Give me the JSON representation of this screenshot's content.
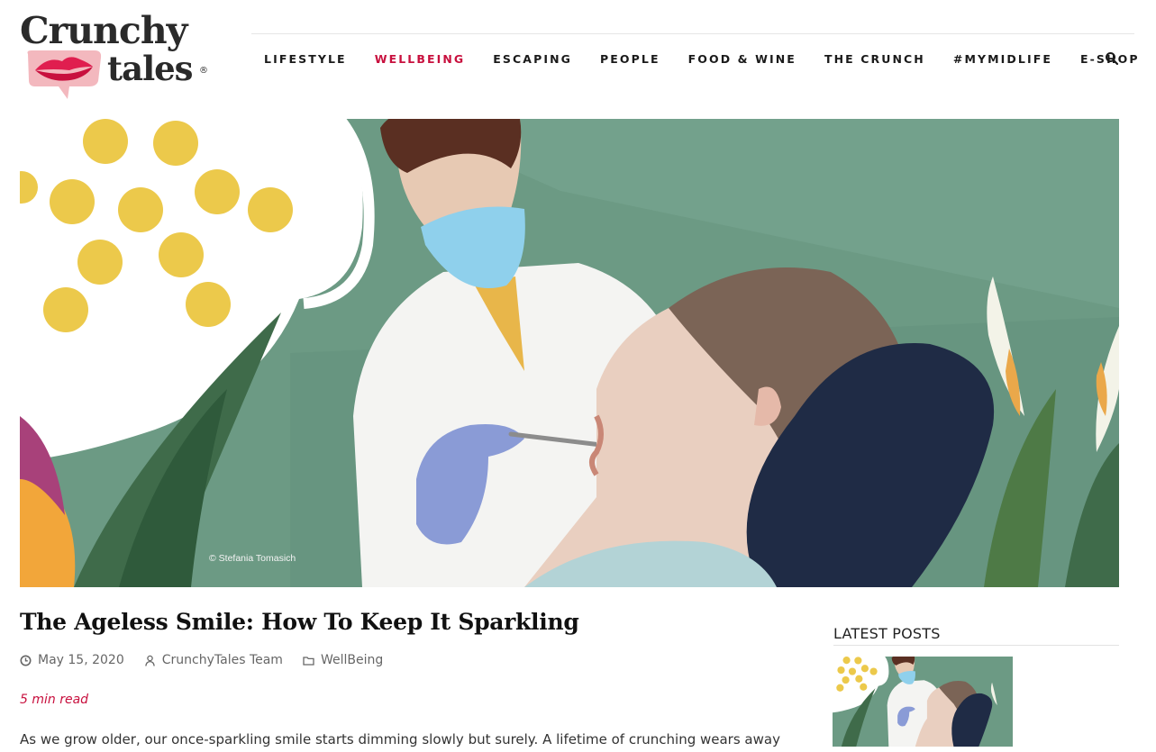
{
  "brand": {
    "logo_word1": "Crunchy",
    "logo_word2": "tales",
    "logo_reg": "®",
    "accent_color": "#c8103e"
  },
  "nav": {
    "items": [
      {
        "label": "LIFESTYLE",
        "active": false
      },
      {
        "label": "WELLBEING",
        "active": true
      },
      {
        "label": "ESCAPING",
        "active": false
      },
      {
        "label": "PEOPLE",
        "active": false
      },
      {
        "label": "FOOD & WINE",
        "active": false
      },
      {
        "label": "THE CRUNCH",
        "active": false
      },
      {
        "label": "#MYMIDLIFE",
        "active": false
      },
      {
        "label": "E-SHOP",
        "active": false
      }
    ],
    "search_icon": "search-icon"
  },
  "hero": {
    "credit": "© Stefania Tomasich"
  },
  "article": {
    "title": "The Ageless Smile: How To Keep It Sparkling",
    "date": "May 15, 2020",
    "author": "CrunchyTales Team",
    "category": "WellBeing",
    "read_time": "5 min read",
    "intro": "As we grow older, our once-sparkling smile starts dimming slowly but surely. A lifetime of crunching wears away the"
  },
  "sidebar": {
    "latest_title": "LATEST POSTS"
  }
}
